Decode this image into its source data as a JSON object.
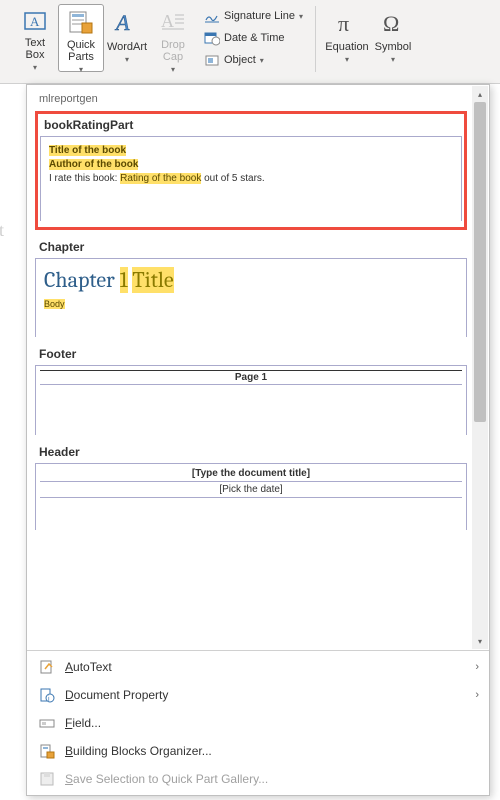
{
  "ribbon": {
    "textbox": {
      "label": "Text Box"
    },
    "quickparts": {
      "label": "Quick Parts"
    },
    "wordart": {
      "label": "WordArt"
    },
    "dropcap": {
      "label": "Drop Cap"
    },
    "signature": {
      "label": "Signature Line"
    },
    "datetime": {
      "label": "Date & Time"
    },
    "object": {
      "label": "Object"
    },
    "equation": {
      "label": "Equation"
    },
    "symbol": {
      "label": "Symbol"
    }
  },
  "doc_fragment": "ot",
  "gallery": {
    "category": "mlreportgen",
    "entries": [
      {
        "name": "bookRatingPart",
        "highlighted": true,
        "lines": {
          "title": "Title of the book",
          "author": "Author of the book",
          "rate_prefix": "I rate this book: ",
          "rate_hl": "Rating of the book",
          "rate_suffix": " out of 5 stars."
        }
      },
      {
        "name": "Chapter",
        "chapter": {
          "prefix": "Chapter ",
          "num": "1",
          "title": "Title"
        },
        "body": "Body"
      },
      {
        "name": "Footer",
        "text": "Page 1"
      },
      {
        "name": "Header",
        "row1": "[Type the document title]",
        "row2": "[Pick the date]"
      }
    ]
  },
  "menu": {
    "autotext": "AutoText",
    "docprop": "Document Property",
    "field": "Field...",
    "bbo": "Building Blocks Organizer...",
    "save": "Save Selection to Quick Part Gallery..."
  }
}
